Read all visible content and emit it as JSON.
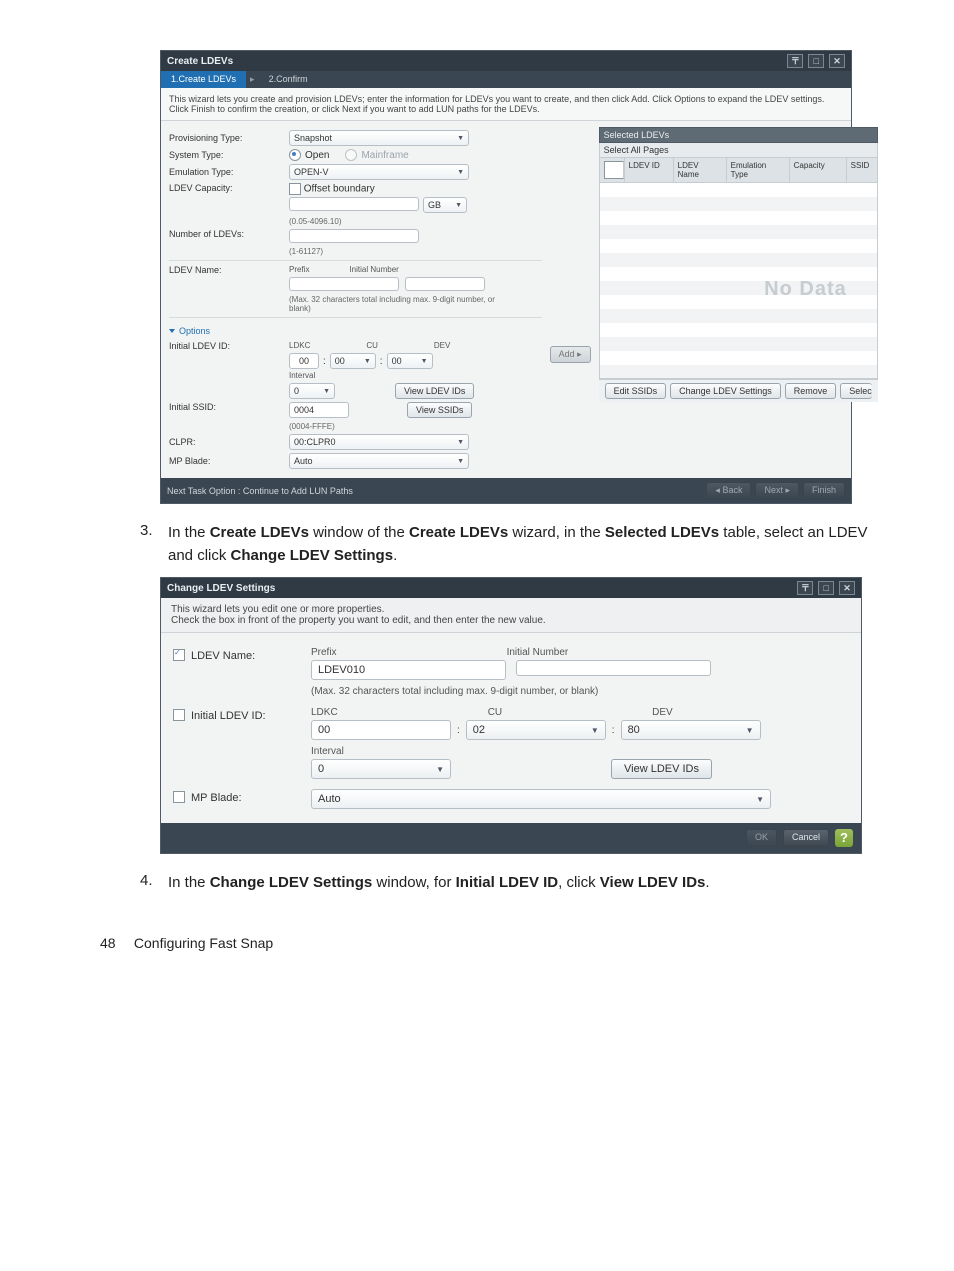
{
  "doc": {
    "page_number": "48",
    "section": "Configuring Fast Snap",
    "step3_prefix": "In the ",
    "step3_b1": "Create LDEVs",
    "step3_mid1": " window of the ",
    "step3_b2": "Create LDEVs",
    "step3_mid2": " wizard, in the ",
    "step3_b3": "Selected LDEVs",
    "step3_mid3": " table, select an LDEV and click ",
    "step3_b4": "Change LDEV Settings",
    "step3_suffix": ".",
    "step4_prefix": "In the ",
    "step4_b1": "Change LDEV Settings",
    "step4_mid1": " window, for ",
    "step4_b2": "Initial LDEV ID",
    "step4_mid2": ", click ",
    "step4_b3": "View LDEV IDs",
    "step4_suffix": ".",
    "num3": "3.",
    "num4": "4."
  },
  "dlg1": {
    "title": "Create LDEVs",
    "steps": {
      "s1": "1.Create LDEVs",
      "s2": "2.Confirm"
    },
    "desc": "This wizard lets you create and provision LDEVs; enter the information for LDEVs you want to create, and then click Add. Click Options to expand the LDEV settings. Click Finish to confirm the creation, or click Next if you want to add LUN paths for the LDEVs.",
    "labels": {
      "provisioning": "Provisioning Type:",
      "system": "System Type:",
      "emulation": "Emulation Type:",
      "capacity": "LDEV Capacity:",
      "num_ldevs": "Number of LDEVs:",
      "ldev_name": "LDEV Name:",
      "options": "Options",
      "init_id": "Initial LDEV ID:",
      "init_ssid": "Initial SSID:",
      "clpr": "CLPR:",
      "mp_blade": "MP Blade:"
    },
    "vals": {
      "provisioning": "Snapshot",
      "sys_open": "Open",
      "sys_mainframe": "Mainframe",
      "emulation": "OPEN-V",
      "offset": "Offset boundary",
      "unit": "GB",
      "cap_range": "(0.05-4096.10)",
      "num_range": "(1-61127)",
      "prefix_lbl": "Prefix",
      "initnum_lbl": "Initial Number",
      "maxchars": "(Max. 32 characters total including max. 9-digit number, or blank)",
      "ldkc_lbl": "LDKC",
      "cu_lbl": "CU",
      "dev_lbl": "DEV",
      "ldkc": "00",
      "cu": "00",
      "dev": "00",
      "interval_lbl": "Interval",
      "interval": "0",
      "view_ldev": "View LDEV IDs",
      "ssid": "0004",
      "ssid_range": "(0004-FFFE)",
      "view_ssids": "View SSIDs",
      "clpr": "00:CLPR0",
      "mp_blade": "Auto",
      "add": "Add ▸"
    },
    "table": {
      "title": "Selected LDEVs",
      "select_all": "Select All Pages",
      "cols": {
        "id": "LDEV ID",
        "name": "LDEV Name",
        "emu": "Emulation Type",
        "cap": "Capacity",
        "ssid": "SSID"
      },
      "nodata": "No Data"
    },
    "table_footer": {
      "edit": "Edit SSIDs",
      "change": "Change LDEV Settings",
      "remove": "Remove",
      "select": "Selec"
    },
    "footer": {
      "note": "Next Task Option : Continue to Add LUN Paths",
      "back": "◂ Back",
      "next": "Next ▸",
      "finish": "Finish"
    }
  },
  "dlg2": {
    "title": "Change LDEV Settings",
    "desc1": "This wizard lets you edit one or more properties.",
    "desc2": "Check the box in front of the property you want to edit, and then enter the new value.",
    "labels": {
      "ldev_name": "LDEV Name:",
      "init_id": "Initial LDEV ID:",
      "mp_blade": "MP Blade:"
    },
    "vals": {
      "prefix_lbl": "Prefix",
      "initnum_lbl": "Initial Number",
      "prefix": "LDEV010",
      "maxchars": "(Max. 32 characters total including max. 9-digit number, or blank)",
      "ldkc_lbl": "LDKC",
      "cu_lbl": "CU",
      "dev_lbl": "DEV",
      "ldkc": "00",
      "cu": "02",
      "dev": "80",
      "interval_lbl": "Interval",
      "interval": "0",
      "view_ldev": "View LDEV IDs",
      "mp_blade": "Auto"
    },
    "footer": {
      "ok": "OK",
      "cancel": "Cancel"
    }
  }
}
